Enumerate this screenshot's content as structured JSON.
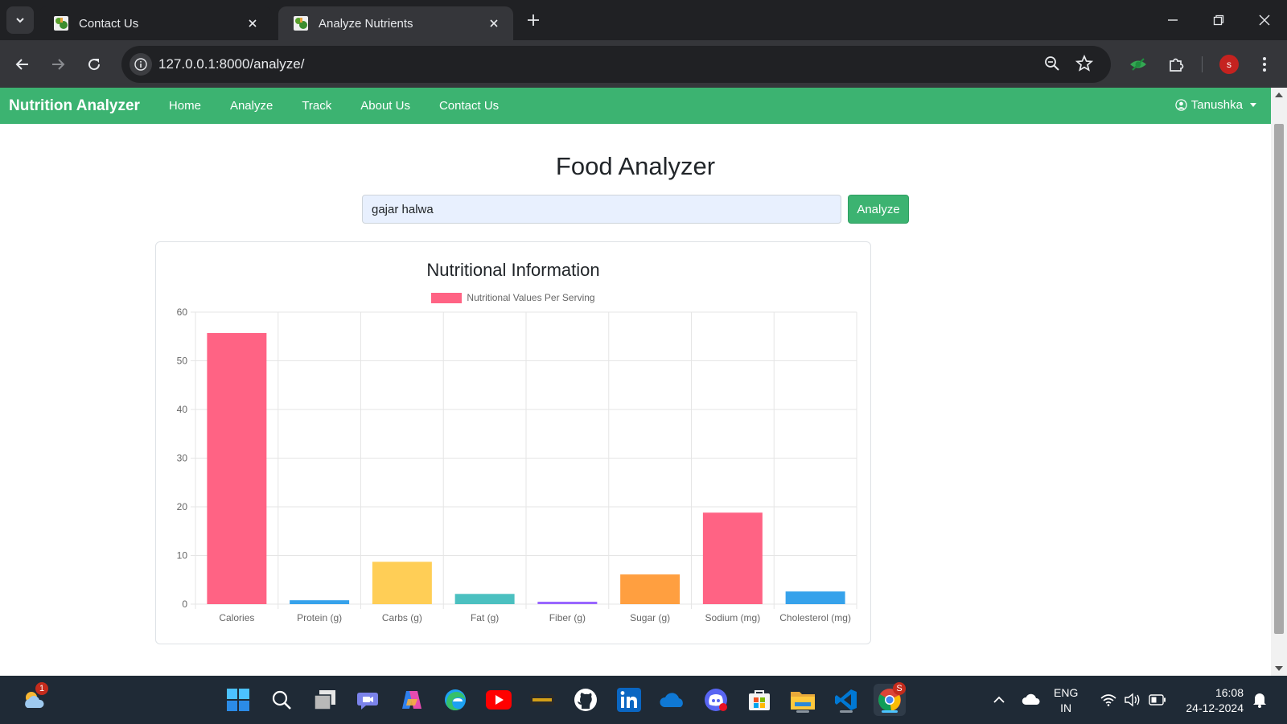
{
  "browser": {
    "tabs": [
      {
        "title": "Contact Us",
        "active": false
      },
      {
        "title": "Analyze Nutrients",
        "active": true
      }
    ],
    "url": "127.0.0.1:8000/analyze/",
    "profile_initial": "s"
  },
  "navbar": {
    "brand": "Nutrition Analyzer",
    "links": [
      "Home",
      "Analyze",
      "Track",
      "About Us",
      "Contact Us"
    ],
    "user": "Tanushka"
  },
  "page": {
    "title": "Food Analyzer",
    "search_value": "gajar halwa",
    "analyze_label": "Analyze"
  },
  "chart_data": {
    "type": "bar",
    "title": "Nutritional Information",
    "categories": [
      "Calories",
      "Protein (g)",
      "Carbs (g)",
      "Fat (g)",
      "Fiber (g)",
      "Sugar (g)",
      "Sodium (mg)",
      "Cholesterol (mg)"
    ],
    "series": [
      {
        "name": "Nutritional Values Per Serving",
        "values": [
          55.7,
          0.8,
          8.7,
          2.1,
          0.5,
          6.1,
          18.8,
          2.6
        ]
      }
    ],
    "bar_colors": [
      "#ff6384",
      "#36a2eb",
      "#ffce56",
      "#4bc0c0",
      "#9966ff",
      "#ff9f40",
      "#ff6384",
      "#36a2eb"
    ],
    "legend_color": "#ff6384",
    "ylim": [
      0,
      60
    ],
    "yticks": [
      0,
      10,
      20,
      30,
      40,
      50,
      60
    ],
    "grid": true,
    "legend_position": "top"
  },
  "taskbar": {
    "weather_badge": "1",
    "chrome_badge": "S",
    "icons": [
      "weather",
      "start",
      "search",
      "task-view",
      "teams",
      "copilot",
      "edge",
      "youtube",
      "college",
      "github",
      "linkedin",
      "onedrive",
      "discord",
      "store",
      "file-explorer",
      "vscode",
      "chrome"
    ],
    "lang_line1": "ENG",
    "lang_line2": "IN",
    "time": "16:08",
    "date": "24-12-2024"
  }
}
